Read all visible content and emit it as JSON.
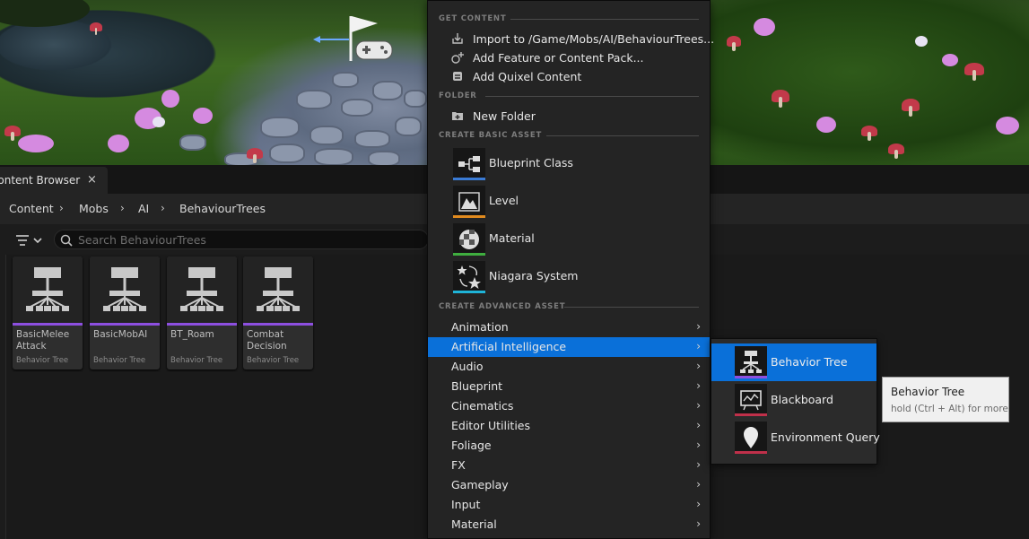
{
  "content_browser": {
    "tab_label": "Content Browser",
    "close_glyph": "×",
    "breadcrumbs": [
      "Content",
      "Mobs",
      "AI",
      "BehaviourTrees"
    ],
    "breadcrumb_separator": "›",
    "search_placeholder": "Search BehaviourTrees",
    "assets": [
      {
        "name": "BasicMelee Attack",
        "type": "Behavior Tree"
      },
      {
        "name": "BasicMobAI",
        "type": "Behavior Tree"
      },
      {
        "name": "BT_Roam",
        "type": "Behavior Tree"
      },
      {
        "name": "Combat Decision",
        "type": "Behavior Tree"
      }
    ],
    "asset_color": "#8d4fe0"
  },
  "context_menu": {
    "sections": {
      "get_content": "GET CONTENT",
      "folder": "FOLDER",
      "create_basic": "CREATE BASIC ASSET",
      "create_advanced": "CREATE ADVANCED ASSET"
    },
    "get_content_items": [
      {
        "label": "Import to /Game/Mobs/AI/BehaviourTrees...",
        "icon": "import-icon"
      },
      {
        "label": "Add Feature or Content Pack...",
        "icon": "feature-pack-icon"
      },
      {
        "label": "Add Quixel Content",
        "icon": "quixel-icon"
      }
    ],
    "folder_items": [
      {
        "label": "New Folder",
        "icon": "new-folder-icon"
      }
    ],
    "basic_assets": [
      {
        "label": "Blueprint Class",
        "icon": "blueprint-class-icon",
        "color": "#3a7bd5"
      },
      {
        "label": "Level",
        "icon": "level-icon",
        "color": "#e08a1e"
      },
      {
        "label": "Material",
        "icon": "material-icon",
        "color": "#3fae3f"
      },
      {
        "label": "Niagara System",
        "icon": "niagara-system-icon",
        "color": "#1fb4d8"
      }
    ],
    "advanced_assets": [
      "Animation",
      "Artificial Intelligence",
      "Audio",
      "Blueprint",
      "Cinematics",
      "Editor Utilities",
      "Foliage",
      "FX",
      "Gameplay",
      "Input",
      "Material"
    ],
    "active_advanced": "Artificial Intelligence",
    "submenu_arrow": "›"
  },
  "ai_submenu": {
    "items": [
      {
        "label": "Behavior Tree",
        "icon": "behavior-tree-icon",
        "color": "#8d4fe0"
      },
      {
        "label": "Blackboard",
        "icon": "blackboard-icon",
        "color": "#c0304a"
      },
      {
        "label": "Environment Query",
        "icon": "environment-query-icon",
        "color": "#c0304a"
      }
    ],
    "active": "Behavior Tree"
  },
  "tooltip": {
    "title": "Behavior Tree",
    "hint": "hold (Ctrl + Alt) for more"
  },
  "colors": {
    "accent": "#0a70d9",
    "menu_bg": "#242424"
  }
}
